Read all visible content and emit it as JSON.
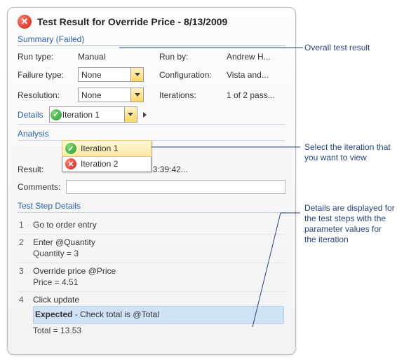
{
  "header": {
    "title": "Test Result for Override Price - 8/13/2009"
  },
  "summary": {
    "heading": "Summary (Failed)",
    "run_type_label": "Run type:",
    "run_type_value": "Manual",
    "run_by_label": "Run by:",
    "run_by_value": "Andrew H...",
    "failure_type_label": "Failure type:",
    "failure_type_value": "None",
    "configuration_label": "Configuration:",
    "configuration_value": "Vista and...",
    "resolution_label": "Resolution:",
    "resolution_value": "None",
    "iterations_label": "Iterations:",
    "iterations_value": "1 of 2 pass..."
  },
  "details": {
    "label": "Details",
    "selected": "Iteration 1",
    "options": [
      "Iteration 1",
      "Iteration 2"
    ]
  },
  "analysis": {
    "heading": "Analysis",
    "result_label": "Result:",
    "date_label_value": "Date started: 8/13/09 3:39:42...",
    "comments_label": "Comments:",
    "comments_value": ""
  },
  "steps": {
    "heading": "Test Step Details",
    "items": [
      {
        "num": "1",
        "text": "Go to order entry",
        "sub": ""
      },
      {
        "num": "2",
        "text": "Enter @Quantity",
        "sub": "Quantity = 3"
      },
      {
        "num": "3",
        "text": "Override price @Price",
        "sub": "Price = 4.51"
      },
      {
        "num": "4",
        "text": "Click update",
        "expected_label": "Expected",
        "expected_text": " - Check total is @Total",
        "sub": "Total = 13.53"
      }
    ]
  },
  "callouts": {
    "c1": "Overall test result",
    "c2": "Select the iteration that you want to view",
    "c3": "Details are displayed for the test steps with the parameter values for the iteration"
  }
}
